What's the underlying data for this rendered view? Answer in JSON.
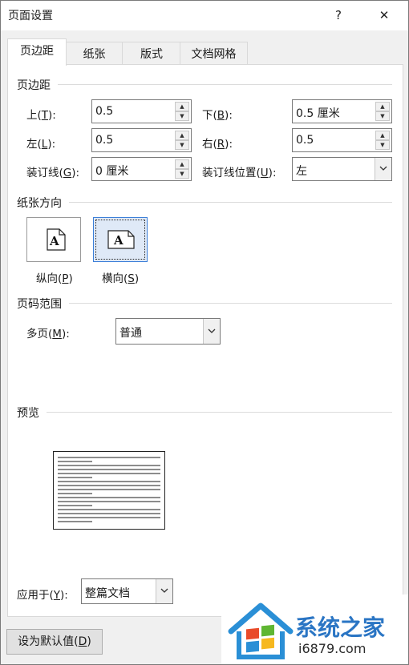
{
  "window": {
    "title": "页面设置",
    "help_label": "?",
    "close_label": "✕"
  },
  "tabs": [
    "页边距",
    "纸张",
    "版式",
    "文档网格"
  ],
  "margins": {
    "section_title": "页边距",
    "top": {
      "label": "上(",
      "key": "T",
      "suffix": "):",
      "value": "0.5"
    },
    "bottom": {
      "label": "下(",
      "key": "B",
      "suffix": "):",
      "value": "0.5 厘米"
    },
    "left": {
      "label": "左(",
      "key": "L",
      "suffix": "):",
      "value": "0.5"
    },
    "right": {
      "label": "右(",
      "key": "R",
      "suffix": "):",
      "value": "0.5"
    },
    "gutter": {
      "label": "装订线(",
      "key": "G",
      "suffix": "):",
      "value": "0 厘米"
    },
    "gutter_pos": {
      "label": "装订线位置(",
      "key": "U",
      "suffix": "):",
      "value": "左"
    }
  },
  "orientation": {
    "section_title": "纸张方向",
    "portrait": {
      "label": "纵向(",
      "key": "P",
      "suffix": ")",
      "glyph": "A"
    },
    "landscape": {
      "label": "横向(",
      "key": "S",
      "suffix": ")",
      "glyph": "A",
      "selected": true
    }
  },
  "pages": {
    "section_title": "页码范围",
    "multiple": {
      "label": "多页(",
      "key": "M",
      "suffix": "):",
      "value": "普通"
    }
  },
  "preview": {
    "section_title": "预览"
  },
  "apply_to": {
    "label": "应用于(",
    "key": "Y",
    "suffix": "):",
    "value": "整篇文档"
  },
  "default_button": {
    "label": "设为默认值(",
    "key": "D",
    "suffix": ")"
  },
  "watermark": {
    "brand": "系统之家",
    "url": "i6879.com"
  },
  "icons": {
    "spin_up": "spin-up-icon",
    "spin_down": "spin-down-icon",
    "dropdown": "chevron-down-icon"
  }
}
